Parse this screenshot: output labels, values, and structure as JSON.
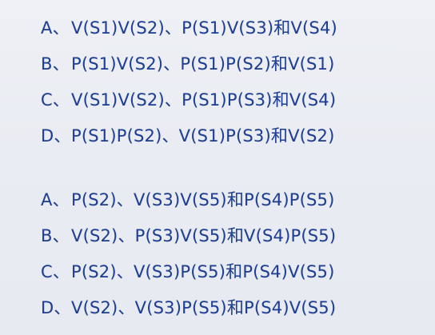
{
  "group1": {
    "options": [
      {
        "letter": "A、",
        "text": "V(S1)V(S2)、P(S1)V(S3)和V(S4)"
      },
      {
        "letter": "B、",
        "text": "P(S1)V(S2)、P(S1)P(S2)和V(S1)"
      },
      {
        "letter": "C、",
        "text": "V(S1)V(S2)、P(S1)P(S3)和V(S4)"
      },
      {
        "letter": "D、",
        "text": "P(S1)P(S2)、V(S1)P(S3)和V(S2)"
      }
    ]
  },
  "group2": {
    "options": [
      {
        "letter": "A、",
        "text": "P(S2)、V(S3)V(S5)和P(S4)P(S5)"
      },
      {
        "letter": "B、",
        "text": "V(S2)、P(S3)V(S5)和V(S4)P(S5)"
      },
      {
        "letter": "C、",
        "text": "P(S2)、V(S3)P(S5)和P(S4)V(S5)"
      },
      {
        "letter": "D、",
        "text": "V(S2)、V(S3)P(S5)和P(S4)V(S5)"
      }
    ]
  }
}
